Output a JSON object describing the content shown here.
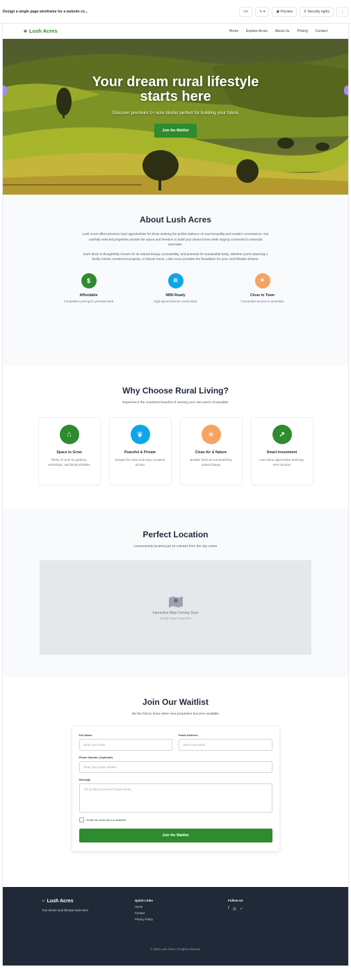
{
  "topbar": {
    "title": "Design a single page wireframe for a website co...",
    "buttons": [
      "</>",
      "✎ ▾",
      "▣ Preview",
      "⚲ Security rights",
      "⋮"
    ]
  },
  "nav": {
    "logo": "Lush Acres",
    "links": [
      "Home",
      "Explore Acres",
      "About Us",
      "Pricing",
      "Contact"
    ]
  },
  "hero": {
    "title_line1": "Your dream rural lifestyle",
    "title_line2": "starts here",
    "subtitle": "Discover premium 1+ acre blocks perfect for building your future",
    "cta": "Join the Waitlist"
  },
  "about": {
    "title": "About Lush Acres",
    "p1": "Lush Acres offers premium land opportunities for those seeking the perfect balance of rural tranquility and modern convenience. Our carefully selected properties provide the space and freedom to build your dream home while staying connected to essential amenities.",
    "p2": "Each block is thoughtfully chosen for its natural beauty, accessibility, and potential for sustainable living. Whether you're planning a family retreat, investment property, or forever home, Lush Acres provides the foundation for your rural lifestyle dreams.",
    "features": [
      {
        "icon": "$",
        "color": "#2e8b2e",
        "title": "Affordable",
        "desc": "Competitive pricing for premium land"
      },
      {
        "icon": "≋",
        "color": "#0ea5e9",
        "title": "NBN Ready",
        "desc": "High-speed internet connectivity"
      },
      {
        "icon": "⌖",
        "color": "#f4a460",
        "title": "Close to Town",
        "desc": "Convenient access to amenities"
      }
    ]
  },
  "why": {
    "title": "Why Choose Rural Living?",
    "subtitle": "Experience the countless benefits of owning your own piece of paradise",
    "cards": [
      {
        "icon": "⌂",
        "color": "#2e8b2e",
        "title": "Space to Grow",
        "desc": "Plenty of room for gardens, workshops, and family activities"
      },
      {
        "icon": "❦",
        "color": "#0ea5e9",
        "title": "Peaceful & Private",
        "desc": "Escape the noise and enjoy complete privacy"
      },
      {
        "icon": "☀",
        "color": "#f4a460",
        "title": "Clean Air & Nature",
        "desc": "Breathe fresh air surrounded by natural beauty"
      },
      {
        "icon": "↗",
        "color": "#2e8b2e",
        "title": "Smart Investment",
        "desc": "Land value appreciation and long-term security"
      }
    ]
  },
  "location": {
    "title": "Perfect Location",
    "subtitle": "Conveniently located just 15 minutes from the city center",
    "map_title": "Interactive Map Coming Soon",
    "map_sub": "Google Maps Integration"
  },
  "waitlist": {
    "title": "Join Our Waitlist",
    "subtitle": "Be the first to know when new properties become available",
    "fields": {
      "name_label": "Full Name",
      "name_ph": "Enter your name",
      "email_label": "Email Address",
      "email_ph": "Enter your email",
      "phone_label": "Phone Number (Optional)",
      "phone_ph": "Enter your phone number",
      "msg_label": "Message",
      "msg_ph": "Tell us about your land requirements..."
    },
    "checkbox": "Notify me when land is available",
    "submit": "Join the Waitlist"
  },
  "footer": {
    "logo": "Lush Acres",
    "tagline": "Your dream rural lifestyle starts here",
    "quick_title": "Quick Links",
    "quick_links": [
      "Home",
      "Contact",
      "Privacy Policy"
    ],
    "follow_title": "Follow Us",
    "social": [
      "f",
      "◎",
      "✓"
    ],
    "copyright": "© 2025 Lush Acres. All rights reserved."
  },
  "colors": {
    "brand": "#2e8b2e",
    "footer_bg": "#1f2937"
  }
}
